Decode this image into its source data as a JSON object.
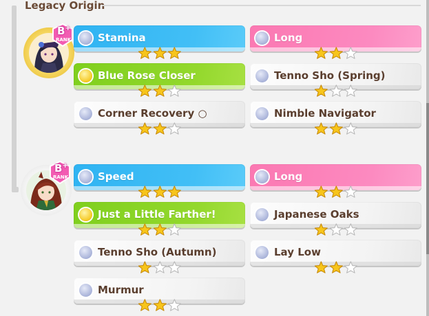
{
  "section": {
    "title": "Legacy Origin"
  },
  "colors": {
    "title": "#6a4a36",
    "blue_card": "#2fb3f2",
    "pink_card": "#fb78b2",
    "green_card": "#7fcf1e",
    "white_card": "#f6f6f6",
    "star_filled": "#f7c51b",
    "star_empty": "#ffffff"
  },
  "parents": [
    {
      "portrait": "portrait-1",
      "rank": {
        "letter": "B",
        "plus": "+",
        "sub": "RANK"
      },
      "sparks": [
        {
          "name": "Stamina",
          "style": "blue",
          "dot": "silver",
          "stars": 3
        },
        {
          "name": "Long",
          "style": "pink",
          "dot": "silver",
          "stars": 2
        },
        {
          "name": "Blue Rose Closer",
          "style": "green",
          "dot": "gold",
          "stars": 2
        },
        {
          "name": "Tenno Sho (Spring)",
          "style": "white",
          "dot": "silver",
          "stars": 1
        },
        {
          "name": "Corner Recovery ○",
          "style": "white",
          "dot": "silver",
          "stars": 2
        },
        {
          "name": "Nimble Navigator",
          "style": "white",
          "dot": "silver",
          "stars": 2
        }
      ]
    },
    {
      "portrait": "portrait-2",
      "rank": {
        "letter": "B",
        "plus": "+",
        "sub": "RANK"
      },
      "sparks": [
        {
          "name": "Speed",
          "style": "blue",
          "dot": "silver",
          "stars": 3
        },
        {
          "name": "Long",
          "style": "pink",
          "dot": "silver",
          "stars": 2
        },
        {
          "name": "Just a Little Farther!",
          "style": "green",
          "dot": "gold",
          "stars": 2
        },
        {
          "name": "Japanese Oaks",
          "style": "white",
          "dot": "silver",
          "stars": 1
        },
        {
          "name": "Tenno Sho (Autumn)",
          "style": "white",
          "dot": "silver",
          "stars": 1
        },
        {
          "name": "Lay Low",
          "style": "white",
          "dot": "silver",
          "stars": 2
        },
        {
          "name": "Murmur",
          "style": "white",
          "dot": "silver",
          "stars": 2
        }
      ]
    }
  ]
}
